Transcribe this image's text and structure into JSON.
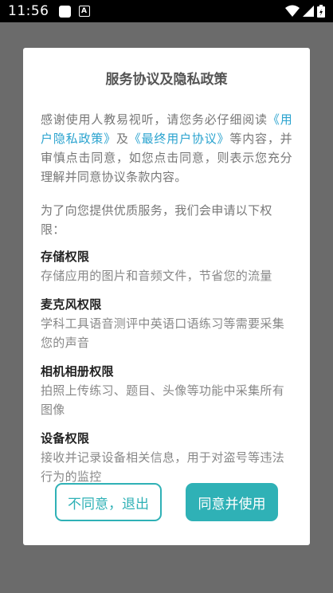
{
  "status_bar": {
    "time": "11:56",
    "notif_label": "A"
  },
  "dialog": {
    "title": "服务协议及隐私政策",
    "intro_pre": "感谢使用人教易视听，请您务必仔细阅读",
    "link_privacy": "《用户隐私政策》",
    "intro_and": "及",
    "link_agreement": "《最终用户协议》",
    "intro_post": "等内容，并审慎点击同意，如您点击同意，则表示您充分理解并同意协议条款内容。",
    "para2": "为了向您提供优质服务，我们会申请以下权限：",
    "permissions": [
      {
        "title": "存储权限",
        "desc": "存储应用的图片和音频文件，节省您的流量"
      },
      {
        "title": "麦克风权限",
        "desc": "学科工具语音测评中英语口语练习等需要采集您的声音"
      },
      {
        "title": "相机相册权限",
        "desc": "拍照上传练习、题目、头像等功能中采集所有图像"
      },
      {
        "title": "设备权限",
        "desc": "接收并记录设备相关信息，用于对盗号等违法行为的监控"
      }
    ],
    "decline_label": "不同意，退出",
    "accept_label": "同意并使用"
  },
  "colors": {
    "accent": "#2fb1b6",
    "link": "#2aa3cf"
  },
  "icons": [
    "wifi-icon",
    "signal-icon",
    "battery-icon"
  ]
}
